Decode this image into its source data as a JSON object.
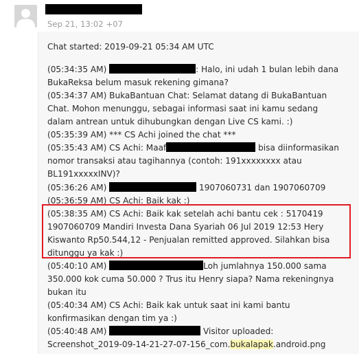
{
  "header": {
    "timestamp": "Sep 21, 13:02 +07"
  },
  "chat": {
    "started": "Chat started: 2019-09-21 05:34 AM UTC",
    "l1": {
      "time": "(05:34:35 AM) ",
      "text": ": Halo, ini udah 1 bulan lebih dana"
    },
    "l2": "BukaReksa belum masuk rekening gimana?",
    "l3": "(05:34:37 AM) BukaBantuan Chat: Selamat datang di BukaBantuan",
    "l4": "Chat. Mohon menunggu, sebagai informasi saat ini kamu sedang",
    "l5": "dalam antrean untuk dihubungkan dengan Live CS kami. :)",
    "l6": "(05:35:39 AM) *** CS Achi joined the chat ***",
    "l7": {
      "prefix": "(05:35:43 AM) CS Achi: Maaf",
      "suffix": " bisa diinformasikan"
    },
    "l8": "nomor transaksi atau tagihannya (contoh: 191xxxxxxxx atau",
    "l9": "BL191xxxxxINV)?",
    "l10": {
      "time": "(05:36:26 AM) ",
      "text": " 1907060731 dan 1907060709"
    },
    "l11": "(05:36:59 AM) CS Achi: Baik kak :)",
    "l12": "(05:38:35 AM) CS Achi: Baik kak setelah achi bantu cek : 5170419",
    "l13": "1907060709 Mandiri Investa Dana Syariah 06 Jul 2019 12:53 Hery",
    "l14": "Kiswanto Rp50.544,12 - Penjualan remitted approved. Silahkan bisa",
    "l15": "ditunggu ya kak :)",
    "l16": {
      "time": "(05:40:10 AM) ",
      "text": "Loh jumlahnya 150.000 sama"
    },
    "l17": "350.000 kok cuma 50.000 ? Trus itu Henry siapa? Nama rekeningnya",
    "l18": "bukan itu",
    "l19": "(05:40:34 AM) CS Achi: Baik kak untuk saat ini kami bantu",
    "l20": "konfirmasikan dengan tim ya :)",
    "l21": {
      "time": "(05:40:48 AM) ",
      "text": " Visitor uploaded:"
    },
    "l22": {
      "prefix": "Screenshot_2019-09-14-21-27-07-156_com.",
      "hl": "bukalapak",
      "suffix": ".android.png"
    }
  }
}
